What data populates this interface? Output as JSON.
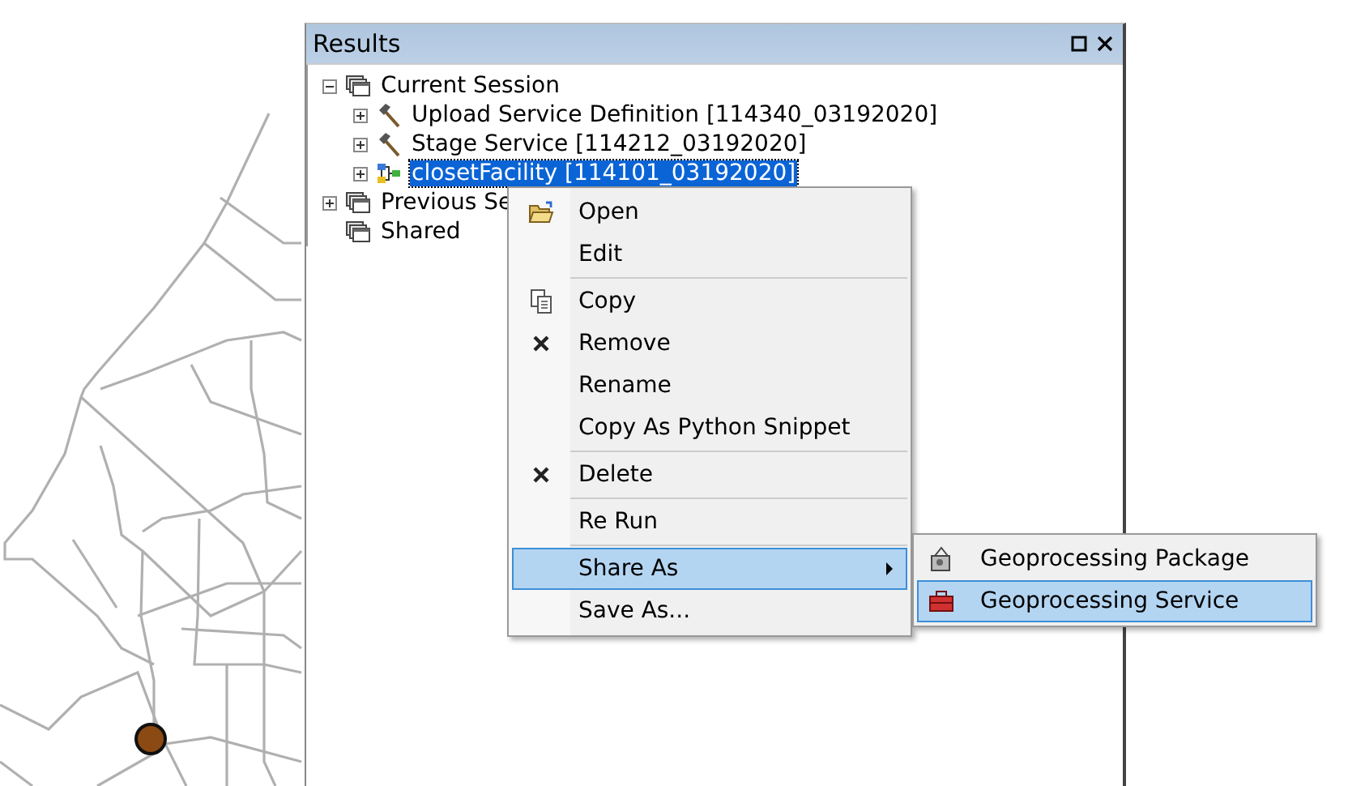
{
  "panel": {
    "title": "Results"
  },
  "tree": [
    {
      "label": "Current Session",
      "kind": "session",
      "expanded": true,
      "selected": false,
      "children": [
        {
          "label": "Upload Service Definition [114340_03192020]",
          "kind": "tool",
          "expanded": false,
          "selected": false
        },
        {
          "label": "Stage Service [114212_03192020]",
          "kind": "tool",
          "expanded": false,
          "selected": false
        },
        {
          "label": "closetFacility [114101_03192020]",
          "kind": "model",
          "expanded": false,
          "selected": true
        }
      ]
    },
    {
      "label": "Previous Se",
      "kind": "session",
      "expanded": false,
      "selected": false
    },
    {
      "label": "Shared",
      "kind": "session",
      "selected": false
    }
  ],
  "context_menu": {
    "groups": [
      [
        {
          "label": "Open",
          "selected": false
        },
        {
          "label": "Edit",
          "selected": false
        }
      ],
      [
        {
          "label": "Copy",
          "selected": false
        },
        {
          "label": "Remove",
          "selected": false
        },
        {
          "label": "Rename",
          "selected": false
        },
        {
          "label": "Copy As Python Snippet",
          "selected": false
        }
      ],
      [
        {
          "label": "Delete",
          "selected": false
        }
      ],
      [
        {
          "label": "Re Run",
          "selected": false
        }
      ],
      [
        {
          "label": "Share As",
          "selected": true,
          "submenu": true
        },
        {
          "label": "Save As...",
          "selected": false
        }
      ]
    ]
  },
  "submenu": [
    {
      "label": "Geoprocessing Package",
      "selected": false
    },
    {
      "label": "Geoprocessing Service",
      "selected": true
    }
  ]
}
